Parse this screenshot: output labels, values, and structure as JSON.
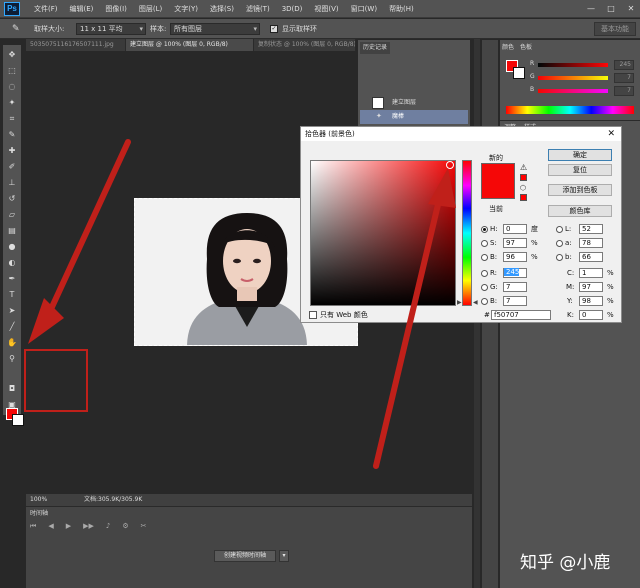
{
  "app": {
    "logo": "Ps",
    "menus": [
      "文件(F)",
      "编辑(E)",
      "图像(I)",
      "图层(L)",
      "文字(Y)",
      "选择(S)",
      "滤镜(T)",
      "3D(D)",
      "视图(V)",
      "窗口(W)",
      "帮助(H)"
    ],
    "window_controls": [
      "—",
      "□",
      "✕"
    ]
  },
  "options_bar": {
    "sample_size_label": "取样大小:",
    "sample_size_value": "11 x 11 平均",
    "sample_label": "样本:",
    "sample_value": "所有图层",
    "show_ring_label": "显示取样环",
    "show_ring_checked": true,
    "workspace_label": "基本功能"
  },
  "doc_tabs": [
    {
      "label": "5035075116176507111.jpg",
      "active": false
    },
    {
      "label": "建立图层 @ 100% (图层 0, RGB/8)",
      "active": true
    },
    {
      "label": "复制状态 @ 100% (图层 0, RGB/8)",
      "active": false
    }
  ],
  "status_bar": {
    "zoom": "100%",
    "doc_size": "文档:305.9K/305.9K"
  },
  "timeline": {
    "title": "时间轴",
    "create_video_button": "创建视频时间轴",
    "dropdown_icon": "▾"
  },
  "history_panel": {
    "tab": "历史记录",
    "items": [
      {
        "label": "建立图层",
        "icon": "thumbnail"
      },
      {
        "label": "魔棒",
        "icon": "magic-wand-icon"
      }
    ]
  },
  "color_panel": {
    "tabs": [
      "颜色",
      "色板"
    ],
    "sliders": [
      {
        "label": "R",
        "value": "245"
      },
      {
        "label": "G",
        "value": "7"
      },
      {
        "label": "B",
        "value": "7"
      }
    ]
  },
  "adjust_panel": {
    "tabs": [
      "调整",
      "样式"
    ]
  },
  "color_picker": {
    "title": "拾色器 (前景色)",
    "close": "✕",
    "new_label": "新的",
    "current_label": "当前",
    "buttons": {
      "ok": "确定",
      "reset": "复位",
      "add_to_swatches": "添加到色板",
      "color_libraries": "颜色库"
    },
    "fields": {
      "H": {
        "value": "0",
        "unit": "度"
      },
      "S": {
        "value": "97",
        "unit": "%"
      },
      "Bv": {
        "value": "96",
        "unit": "%"
      },
      "R": {
        "value": "245"
      },
      "G": {
        "value": "7"
      },
      "B": {
        "value": "7"
      },
      "L": {
        "value": "52"
      },
      "a": {
        "value": "78"
      },
      "b": {
        "value": "66"
      },
      "C": {
        "value": "1",
        "unit": "%"
      },
      "M": {
        "value": "97",
        "unit": "%"
      },
      "Y": {
        "value": "98",
        "unit": "%"
      },
      "K": {
        "value": "0",
        "unit": "%"
      }
    },
    "web_only_label": "只有 Web 颜色",
    "hex": "f50707",
    "selected_color": "#f50707"
  },
  "watermark": "知乎 @小鹿"
}
